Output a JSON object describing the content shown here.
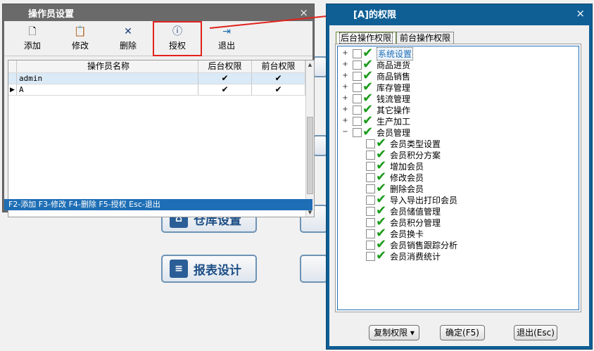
{
  "background_tiles": {
    "warehouse": "仓库设置",
    "report": "报表设计"
  },
  "operator_window": {
    "title": "操作员设置",
    "close": "×",
    "toolbar": {
      "add": "添加",
      "edit": "修改",
      "delete": "删除",
      "authorize": "授权",
      "exit": "退出"
    },
    "grid": {
      "headers": {
        "name": "操作员名称",
        "backend": "后台权限",
        "frontend": "前台权限"
      },
      "rows": [
        {
          "name": "admin",
          "backend": "✔",
          "frontend": "✔"
        },
        {
          "name": "A",
          "backend": "✔",
          "frontend": "✔"
        }
      ]
    },
    "status": "F2-添加 F3-修改 F4-删除 F5-授权 Esc-退出"
  },
  "permission_window": {
    "title": "[A]的权限",
    "close": "×",
    "tabs": {
      "backend": "后台操作权限",
      "frontend": "前台操作权限"
    },
    "tree": {
      "top": [
        "系统设置",
        "商品进货",
        "商品销售",
        "库存管理",
        "钱流管理",
        "其它操作",
        "生产加工",
        "会员管理"
      ],
      "member_children": [
        "会员类型设置",
        "会员积分方案",
        "增加会员",
        "修改会员",
        "删除会员",
        "导入导出打印会员",
        "会员储值管理",
        "会员积分管理",
        "会员换卡",
        "会员销售跟踪分析",
        "会员消费统计"
      ],
      "expand_collapsed": "+",
      "expand_open": "−",
      "check": "✔"
    },
    "buttons": {
      "copy": "复制权限 ▾",
      "ok": "确定(F5)",
      "exit": "退出(Esc)"
    }
  },
  "colors": {
    "title_bar_blue": "#0f5f95",
    "status_bar_blue": "#1e6eb5",
    "highlight_red": "#e0231c",
    "check_green": "#1a9a1a"
  }
}
